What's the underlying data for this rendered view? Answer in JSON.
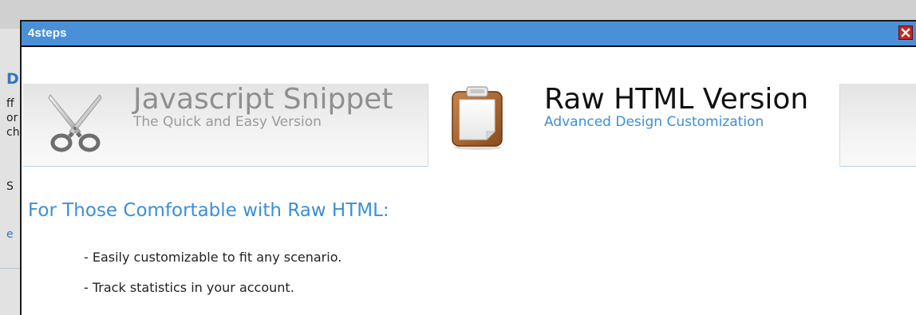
{
  "dialog": {
    "title": "4steps",
    "close_icon": "close-icon"
  },
  "background_page": {
    "fragments": [
      "D",
      "ff",
      "or",
      "ch",
      "S",
      "e"
    ]
  },
  "tabs": [
    {
      "title": "Javascript Snippet",
      "subtitle": "The Quick and Easy Version",
      "icon": "scissors-icon",
      "active": false
    },
    {
      "title": "Raw HTML Version",
      "subtitle": "Advanced Design Customization",
      "icon": "clipboard-icon",
      "active": true
    }
  ],
  "content": {
    "heading": "For Those Comfortable with Raw HTML:",
    "bullets": [
      "- Easily customizable to fit any scenario.",
      "- Track statistics in your account."
    ]
  },
  "colors": {
    "titlebar": "#4a90d9",
    "close_button": "#c9261f",
    "accent_blue": "#3b8fd8",
    "clipboard_brown": "#a85e2a"
  }
}
